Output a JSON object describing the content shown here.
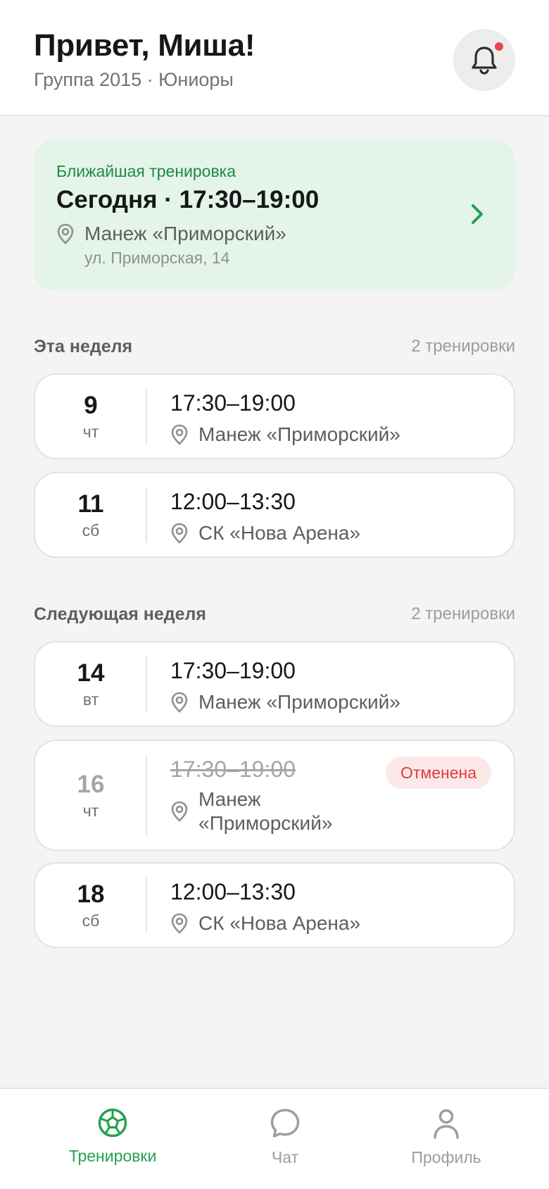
{
  "header": {
    "greeting": "Привет, Миша!",
    "group": "Группа 2015 · Юниоры",
    "notifications_icon": "bell-icon",
    "has_unread": true
  },
  "next_training": {
    "label": "Ближайшая тренировка",
    "time": "Сегодня · 17:30–19:00",
    "place": "Манеж «Приморский»",
    "address": "ул. Приморская, 14"
  },
  "sections": [
    {
      "title": "Эта неделя",
      "count": "2 тренировки",
      "items": [
        {
          "day": "9",
          "weekday": "чт",
          "time": "17:30–19:00",
          "place": "Манеж «Приморский»"
        },
        {
          "day": "11",
          "weekday": "сб",
          "time": "12:00–13:30",
          "place": "СК «Нова Арена»"
        }
      ]
    },
    {
      "title": "Следующая неделя",
      "count": "2 тренировки",
      "items": [
        {
          "day": "14",
          "weekday": "вт",
          "time": "17:30–19:00",
          "place": "Манеж «Приморский»"
        },
        {
          "day": "16",
          "weekday": "чт",
          "time": "17:30–19:00",
          "place": "Манеж «Приморский»",
          "status": "Отменена"
        },
        {
          "day": "18",
          "weekday": "сб",
          "time": "12:00–13:30",
          "place": "СК «Нова Арена»"
        }
      ]
    }
  ],
  "tabs": [
    {
      "label": "Тренировки",
      "icon": "soccer-ball-icon",
      "active": true
    },
    {
      "label": "Чат",
      "icon": "chat-bubble-icon",
      "active": false
    },
    {
      "label": "Профиль",
      "icon": "user-icon",
      "active": false
    }
  ],
  "colors": {
    "accent": "#22a24e",
    "accent_bg": "#e4f4e9",
    "cancel": "#dc3b42",
    "cancel_bg": "#fde8e8"
  }
}
